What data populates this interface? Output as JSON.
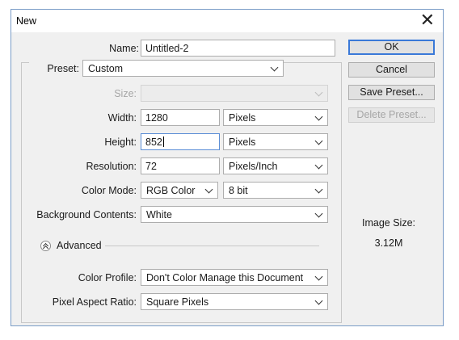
{
  "dialog": {
    "title": "New"
  },
  "name": {
    "label": "Name:",
    "value": "Untitled-2"
  },
  "preset": {
    "label": "Preset:",
    "value": "Custom"
  },
  "size": {
    "label": "Size:",
    "value": ""
  },
  "width": {
    "label": "Width:",
    "value": "1280",
    "unit": "Pixels"
  },
  "height": {
    "label": "Height:",
    "value": "852",
    "unit": "Pixels"
  },
  "resolution": {
    "label": "Resolution:",
    "value": "72",
    "unit": "Pixels/Inch"
  },
  "color_mode": {
    "label": "Color Mode:",
    "mode": "RGB Color",
    "depth": "8 bit"
  },
  "background": {
    "label": "Background Contents:",
    "value": "White"
  },
  "advanced": {
    "label": "Advanced"
  },
  "color_profile": {
    "label": "Color Profile:",
    "value": "Don't Color Manage this Document"
  },
  "pixel_aspect": {
    "label": "Pixel Aspect Ratio:",
    "value": "Square Pixels"
  },
  "buttons": {
    "ok": "OK",
    "cancel": "Cancel",
    "save_preset": "Save Preset...",
    "delete_preset": "Delete Preset..."
  },
  "image_size": {
    "label": "Image Size:",
    "value": "3.12M"
  },
  "colors": {
    "dialog_bg": "#f0f0f0",
    "focus_blue": "#3a79d8",
    "disabled_text": "#a6a6a6"
  }
}
